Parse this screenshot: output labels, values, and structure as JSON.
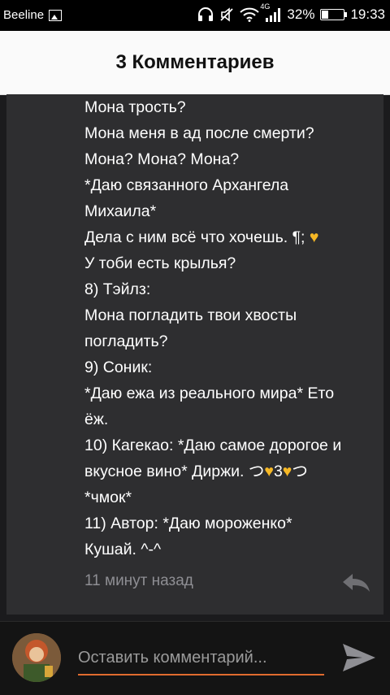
{
  "status_bar": {
    "carrier": "Beeline",
    "network": "4G",
    "battery": "32%",
    "battery_level": 0.32,
    "time": "19:33"
  },
  "header": {
    "title": "3 Комментариев"
  },
  "comment": {
    "lines": [
      "Мона трость?",
      "Мона меня в ад после смерти?",
      "Мона? Мона? Мона?",
      "*Даю связанного Архангела",
      "Михаила*",
      "Дела с ним всё что хочешь. ¶; 🧡",
      "У тоби есть крылья?",
      "8) Тэйлз:",
      "Мона погладить твои хвосты",
      "погладить?",
      "9) Соник:",
      "*Даю ежа из реального мира* Ето",
      "ёж.",
      "10) Кагекао: *Даю самое дорогое и",
      "вкусное вино* Диржи. つ🧡3🧡つ",
      "*чмок*",
      "11) Автор: *Даю мороженко*",
      "Кушай. ^-^"
    ],
    "timestamp": "11 минут назад"
  },
  "input": {
    "placeholder": "Оставить комментарий..."
  },
  "icons": {
    "gallery": "image-icon",
    "headphones": "headphones-icon",
    "mute": "mute-icon",
    "wifi": "wifi-icon",
    "signal": "signal-icon",
    "battery": "battery-icon",
    "reply": "reply-icon",
    "send": "send-icon"
  },
  "colors": {
    "accent": "#e06b2f",
    "heart": "#f6b825",
    "card": "#2e2e30"
  }
}
